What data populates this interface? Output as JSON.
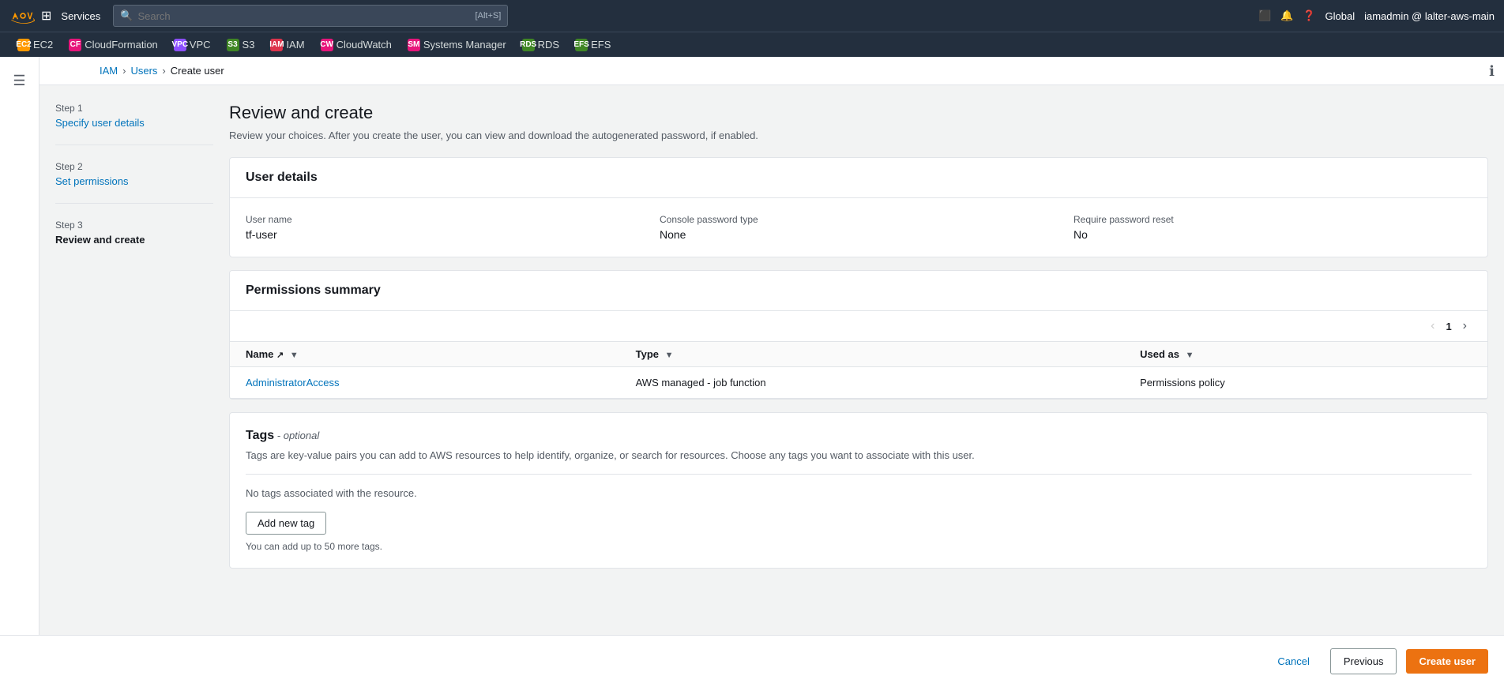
{
  "topnav": {
    "services_label": "Services",
    "search_placeholder": "Search",
    "search_shortcut": "[Alt+S]",
    "region": "Global",
    "user": "iamadmin @ lalter-aws-main"
  },
  "servicebar": {
    "items": [
      {
        "label": "EC2",
        "badge_color": "#f90",
        "badge_text": "EC2"
      },
      {
        "label": "CloudFormation",
        "badge_color": "#e7157b",
        "badge_text": "CF"
      },
      {
        "label": "VPC",
        "badge_color": "#8c4fff",
        "badge_text": "VPC"
      },
      {
        "label": "S3",
        "badge_color": "#3f8624",
        "badge_text": "S3"
      },
      {
        "label": "IAM",
        "badge_color": "#dd344c",
        "badge_text": "IAM"
      },
      {
        "label": "CloudWatch",
        "badge_color": "#e7157b",
        "badge_text": "CW"
      },
      {
        "label": "Systems Manager",
        "badge_color": "#e7157b",
        "badge_text": "SM"
      },
      {
        "label": "RDS",
        "badge_color": "#3f8624",
        "badge_text": "RDS"
      },
      {
        "label": "EFS",
        "badge_color": "#3f8624",
        "badge_text": "EFS"
      }
    ]
  },
  "breadcrumb": {
    "items": [
      "IAM",
      "Users"
    ],
    "current": "Create user"
  },
  "steps": [
    {
      "label": "Step 1",
      "name": "Specify user details",
      "active": false
    },
    {
      "label": "Step 2",
      "name": "Set permissions",
      "active": false
    },
    {
      "label": "Step 3",
      "name": "Review and create",
      "active": true
    }
  ],
  "page": {
    "title": "Review and create",
    "description": "Review your choices. After you create the user, you can view and download the autogenerated password, if enabled."
  },
  "user_details": {
    "section_title": "User details",
    "fields": [
      {
        "label": "User name",
        "value": "tf-user"
      },
      {
        "label": "Console password type",
        "value": "None"
      },
      {
        "label": "Require password reset",
        "value": "No"
      }
    ]
  },
  "permissions": {
    "section_title": "Permissions summary",
    "page_number": "1",
    "columns": [
      {
        "label": "Name",
        "has_filter": true,
        "has_link": true
      },
      {
        "label": "Type",
        "has_filter": true
      },
      {
        "label": "Used as",
        "has_filter": true
      }
    ],
    "rows": [
      {
        "name": "AdministratorAccess",
        "name_is_link": true,
        "type": "AWS managed - job function",
        "used_as": "Permissions policy"
      }
    ]
  },
  "tags": {
    "section_title": "Tags",
    "optional_label": "- optional",
    "description": "Tags are key-value pairs you can add to AWS resources to help identify, organize, or search for resources. Choose any tags you want to associate with this user.",
    "no_tags_message": "No tags associated with the resource.",
    "add_button": "Add new tag",
    "limit_text": "You can add up to 50 more tags."
  },
  "footer": {
    "cancel_label": "Cancel",
    "previous_label": "Previous",
    "create_label": "Create user"
  }
}
